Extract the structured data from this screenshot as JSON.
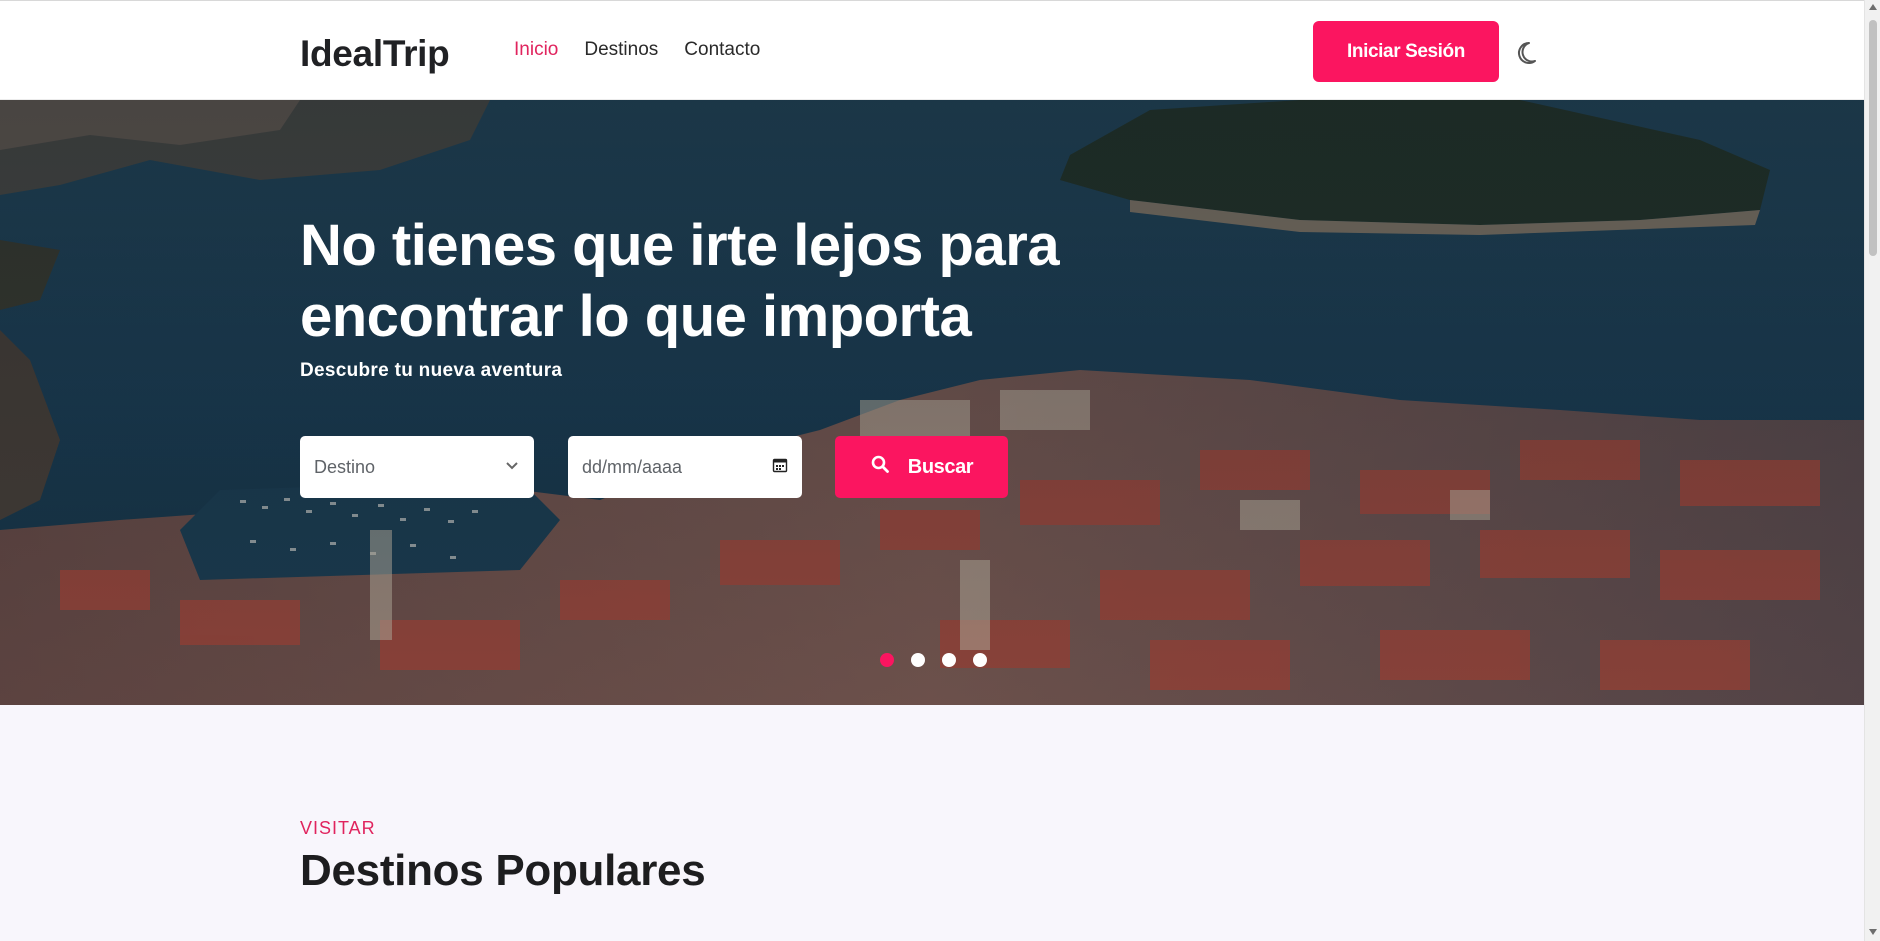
{
  "header": {
    "logo": "IdealTrip",
    "nav": [
      {
        "label": "Inicio",
        "active": true
      },
      {
        "label": "Destinos",
        "active": false
      },
      {
        "label": "Contacto",
        "active": false
      }
    ],
    "login_label": "Iniciar Sesión",
    "theme_icon": "moon-icon"
  },
  "hero": {
    "title_line1": "No tienes que irte lejos para",
    "title_line2": "encontrar lo que importa",
    "subtitle": "Descubre tu nueva aventura",
    "search": {
      "destination_value": "Destino",
      "date_placeholder": "dd/mm/aaaa",
      "button_label": "Buscar",
      "button_icon": "search-icon"
    },
    "slides": {
      "count": 4,
      "active_index": 0
    }
  },
  "popular": {
    "eyebrow": "VISITAR",
    "title": "Destinos Populares"
  },
  "colors": {
    "accent": "#fb1560",
    "nav_active": "#e0245e",
    "section_bg": "#f8f6fc"
  }
}
